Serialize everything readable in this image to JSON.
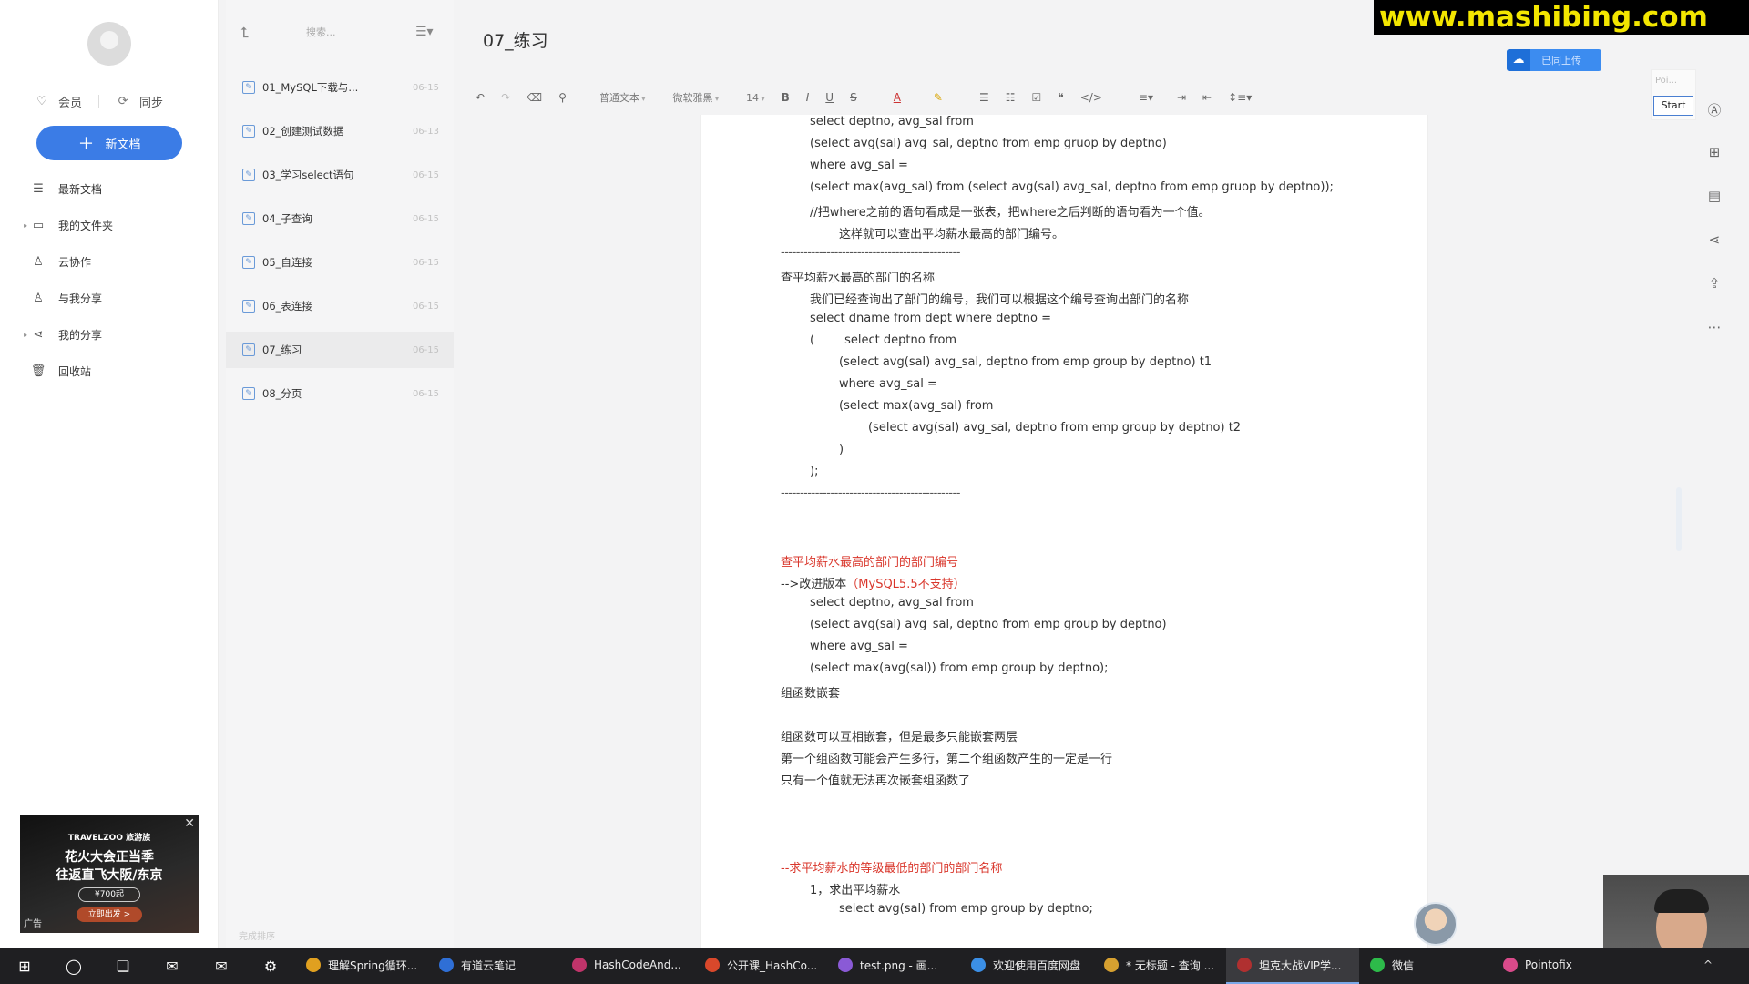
{
  "sidebar": {
    "member_label": "会员",
    "sync_label": "同步",
    "new_doc_label": "新文档",
    "items": [
      {
        "label": "最新文档",
        "icon": "layers-icon"
      },
      {
        "label": "我的文件夹",
        "icon": "folder-icon"
      },
      {
        "label": "云协作",
        "icon": "collab-icon"
      },
      {
        "label": "与我分享",
        "icon": "shared-with-me-icon"
      },
      {
        "label": "我的分享",
        "icon": "share-icon"
      },
      {
        "label": "回收站",
        "icon": "trash-icon"
      }
    ],
    "ad": {
      "brand": "TRAVELZOO 旅游族",
      "line1": "花火大会正当季",
      "line2": "往返直飞大阪/东京",
      "price": "¥700起",
      "cta": "立即出发 >",
      "tag": "广告"
    }
  },
  "doclist": {
    "search_placeholder": "搜索...",
    "footer": "完成排序",
    "items": [
      {
        "title": "01_MySQL下载与...",
        "date": "06-15"
      },
      {
        "title": "02_创建测试数据",
        "date": "06-13"
      },
      {
        "title": "03_学习select语句",
        "date": "06-15"
      },
      {
        "title": "04_子查询",
        "date": "06-15"
      },
      {
        "title": "05_自连接",
        "date": "06-15"
      },
      {
        "title": "06_表连接",
        "date": "06-15"
      },
      {
        "title": "07_练习",
        "date": "06-15"
      },
      {
        "title": "08_分页",
        "date": "06-15"
      }
    ],
    "active_index": 6
  },
  "editor": {
    "title": "07_练习",
    "toolbar": {
      "paragraph_style": "普通文本",
      "font_family": "微软雅黑",
      "font_size": "14"
    },
    "upload_label": "已同上传",
    "start_panel_label": "Poi...",
    "start_label": "Start",
    "lines": [
      {
        "text": "select deptno, avg_sal from",
        "indent": 1
      },
      {
        "text": "(select avg(sal) avg_sal, deptno from emp gruop by deptno)",
        "indent": 1
      },
      {
        "text": "where avg_sal =",
        "indent": 1
      },
      {
        "text": "(select max(avg_sal) from (select avg(sal) avg_sal, deptno from emp gruop by deptno));",
        "indent": 1
      },
      {
        "text": "//把where之前的语句看成是一张表，把where之后判断的语句看为一个值。",
        "indent": 1
      },
      {
        "text": "这样就可以查出平均薪水最高的部门编号。",
        "indent": 2
      },
      {
        "text": "-----------------------------------------------",
        "indent": 0,
        "style": "dash"
      },
      {
        "text": "查平均薪水最高的部门的名称",
        "indent": 0
      },
      {
        "text": "我们已经查询出了部门的编号，我们可以根据这个编号查询出部门的名称",
        "indent": 1
      },
      {
        "text": "select dname from dept where deptno =",
        "indent": 1
      },
      {
        "text": "(        select deptno from",
        "indent": 1
      },
      {
        "text": "(select avg(sal) avg_sal, deptno from emp group by deptno) t1",
        "indent": 2
      },
      {
        "text": "where avg_sal =",
        "indent": 2
      },
      {
        "text": "(select max(avg_sal) from",
        "indent": 2
      },
      {
        "text": "(select avg(sal) avg_sal, deptno from emp group by deptno) t2",
        "indent": 3
      },
      {
        "text": ")",
        "indent": 2
      },
      {
        "text": ");",
        "indent": 1
      },
      {
        "text": "-----------------------------------------------",
        "indent": 0,
        "style": "dash"
      },
      {
        "text": "",
        "indent": 0
      },
      {
        "text": "",
        "indent": 0
      },
      {
        "text": "查平均薪水最高的部门的部门编号",
        "indent": 0,
        "style": "red"
      },
      {
        "text": "-->改进版本",
        "indent": 0,
        "red_suffix": "（MySQL5.5不支持）"
      },
      {
        "text": "select deptno, avg_sal from",
        "indent": 1
      },
      {
        "text": "(select avg(sal) avg_sal, deptno from emp group by deptno)",
        "indent": 1
      },
      {
        "text": "where avg_sal =",
        "indent": 1
      },
      {
        "text": "(select max(avg(sal)) from emp group by deptno);",
        "indent": 1
      },
      {
        "text": "组函数嵌套",
        "indent": 0
      },
      {
        "text": "",
        "indent": 0
      },
      {
        "text": "组函数可以互相嵌套，但是最多只能嵌套两层",
        "indent": 0
      },
      {
        "text": "第一个组函数可能会产生多行，第二个组函数产生的一定是一行",
        "indent": 0
      },
      {
        "text": "只有一个值就无法再次嵌套组函数了",
        "indent": 0
      },
      {
        "text": "",
        "indent": 0
      },
      {
        "text": "",
        "indent": 0
      },
      {
        "text": "",
        "indent": 0
      },
      {
        "text": "--求平均薪水的等级最低的部门的部门名称",
        "indent": 0,
        "style": "red"
      },
      {
        "text": "1，求出平均薪水",
        "indent": 1
      },
      {
        "text": "select avg(sal) from emp group by deptno;",
        "indent": 2
      }
    ]
  },
  "watermark": "www.mashibing.com",
  "taskbar": {
    "apps": [
      {
        "label": "理解Spring循环...",
        "color": "#e0a020"
      },
      {
        "label": "有道云笔记",
        "color": "#2f6fd6"
      },
      {
        "label": "HashCodeAnd...",
        "color": "#c0346a"
      },
      {
        "label": "公开课_HashCo...",
        "color": "#d9482b"
      },
      {
        "label": "test.png - 画...",
        "color": "#8a5ad6"
      },
      {
        "label": "欢迎使用百度网盘",
        "color": "#3b8fe6"
      },
      {
        "label": "* 无标题 - 查询 ...",
        "color": "#d6a030"
      },
      {
        "label": "坦克大战VIP学...",
        "color": "#b03030"
      },
      {
        "label": "微信",
        "color": "#2dbb4a"
      },
      {
        "label": "Pointofix",
        "color": "#d84a8a"
      }
    ],
    "active_index": 7
  }
}
